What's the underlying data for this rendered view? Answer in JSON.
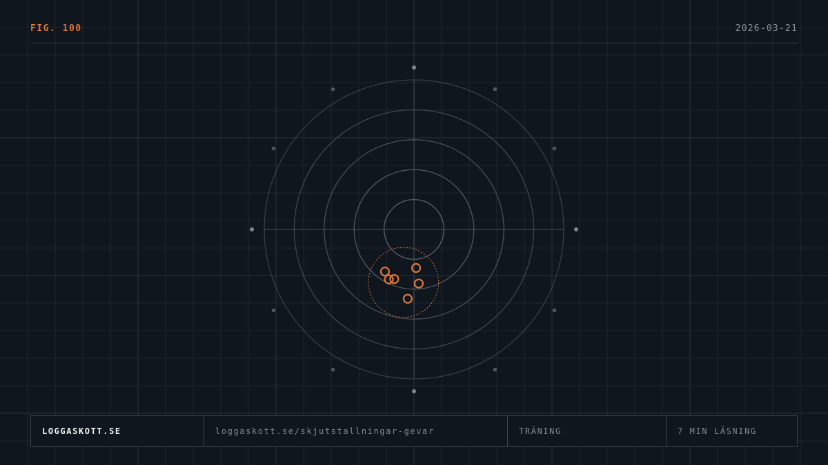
{
  "figure": {
    "label": "FIG. 100",
    "date": "2026-03-21"
  },
  "colors": {
    "background": "#10161e",
    "accent": "#e0773c",
    "ring": "#5a626c",
    "grid": "#1f2731"
  },
  "target": {
    "ring_count": 5,
    "shots": [
      {
        "x": -0.97,
        "y": -1.41
      },
      {
        "x": -0.66,
        "y": -1.66
      },
      {
        "x": -0.84,
        "y": -1.67
      },
      {
        "x": 0.07,
        "y": -1.29
      },
      {
        "x": 0.16,
        "y": -1.81
      },
      {
        "x": -0.21,
        "y": -2.32
      }
    ],
    "group_center": {
      "x": -0.35,
      "y": -1.77
    },
    "group_radius": 1.17
  },
  "footer": {
    "site": "LOGGASKOTT.SE",
    "url": "loggaskott.se/skjutstallningar-gevar",
    "category": "TRÄNING",
    "read_time": "7 MIN LÄSNING"
  }
}
